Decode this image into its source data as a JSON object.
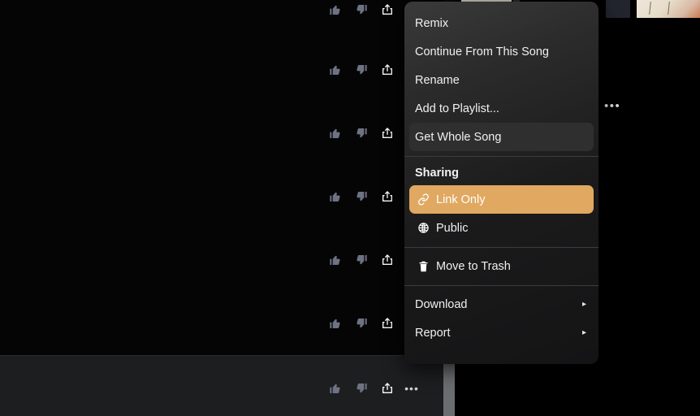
{
  "menu": {
    "items": [
      {
        "id": "remix",
        "label": "Remix",
        "icon": "",
        "state": "normal",
        "submenu": false
      },
      {
        "id": "continue",
        "label": "Continue From This Song",
        "icon": "",
        "state": "normal",
        "submenu": false
      },
      {
        "id": "rename",
        "label": "Rename",
        "icon": "",
        "state": "normal",
        "submenu": false
      },
      {
        "id": "playlist",
        "label": "Add to Playlist...",
        "icon": "",
        "state": "normal",
        "submenu": false
      },
      {
        "id": "whole",
        "label": "Get Whole Song",
        "icon": "",
        "state": "selected",
        "submenu": false
      }
    ],
    "sharing_section_label": "Sharing",
    "sharing_items": [
      {
        "id": "link-only",
        "label": "Link Only",
        "icon": "link-icon",
        "state": "highlighted",
        "submenu": false
      },
      {
        "id": "public",
        "label": "Public",
        "icon": "globe-icon",
        "state": "normal",
        "submenu": false
      }
    ],
    "destructive_items": [
      {
        "id": "trash",
        "label": "Move to Trash",
        "icon": "trash-icon",
        "state": "normal",
        "submenu": false
      }
    ],
    "footer_items": [
      {
        "id": "download",
        "label": "Download",
        "icon": "",
        "state": "normal",
        "submenu": true
      },
      {
        "id": "report",
        "label": "Report",
        "icon": "",
        "state": "normal",
        "submenu": true
      }
    ],
    "submenu_glyph": "▸",
    "highlight_color": "#e0a860",
    "selected_color": "#2f2f30",
    "background_color": "#1b1b1c",
    "text_color": "#f0f0f0"
  },
  "track_rows": {
    "count": 6,
    "actions": [
      {
        "id": "thumbs-up",
        "icon": "thumbs-up-icon",
        "color": "#6d7382"
      },
      {
        "id": "thumbs-down",
        "icon": "thumbs-down-icon",
        "color": "#6d7382"
      },
      {
        "id": "share",
        "icon": "share-icon",
        "color": "#ffffff"
      }
    ]
  },
  "player_bar": {
    "actions": [
      {
        "id": "thumbs-up",
        "icon": "thumbs-up-icon"
      },
      {
        "id": "thumbs-down",
        "icon": "thumbs-down-icon"
      },
      {
        "id": "share",
        "icon": "share-icon"
      },
      {
        "id": "more",
        "icon": "ellipsis-icon",
        "glyph": "•••"
      }
    ]
  },
  "misc": {
    "more_options_glyph": "•••"
  }
}
